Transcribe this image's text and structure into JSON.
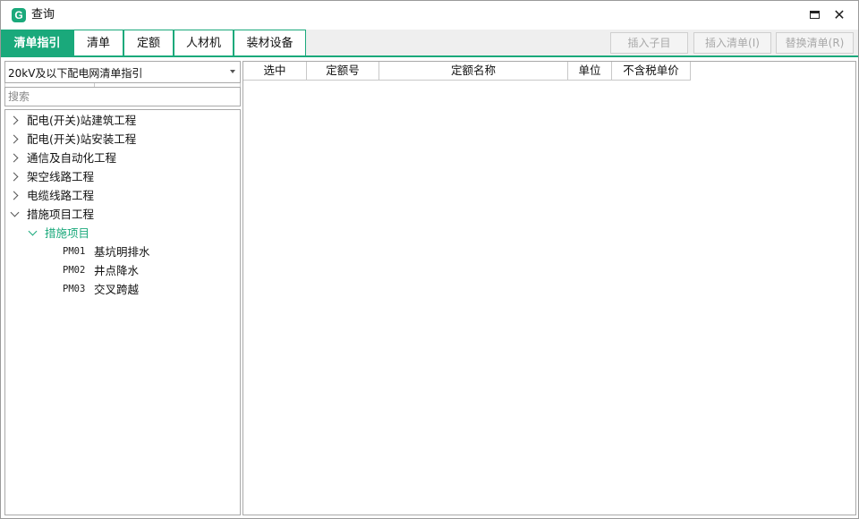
{
  "window": {
    "title": "查询",
    "logo_letter": "G",
    "accent_color": "#1aa97b"
  },
  "tabs": [
    {
      "label": "清单指引",
      "active": true
    },
    {
      "label": "清单",
      "active": false
    },
    {
      "label": "定额",
      "active": false
    },
    {
      "label": "人材机",
      "active": false
    },
    {
      "label": "装材设备",
      "active": false
    }
  ],
  "toolbar": {
    "insert_child": "插入子目",
    "insert_list": "插入清单(I)",
    "replace_list": "替换清单(R)"
  },
  "left_panel": {
    "guide_select_value": "20kV及以下配电网清单指引",
    "search_placeholder": "搜索",
    "tree": [
      {
        "label": "配电(开关)站建筑工程",
        "expanded": false
      },
      {
        "label": "配电(开关)站安装工程",
        "expanded": false
      },
      {
        "label": "通信及自动化工程",
        "expanded": false
      },
      {
        "label": "架空线路工程",
        "expanded": false
      },
      {
        "label": "电缆线路工程",
        "expanded": false
      },
      {
        "label": "措施项目工程",
        "expanded": true
      },
      {
        "label": "措施项目",
        "expanded": true,
        "selected": true
      },
      {
        "code": "PM01",
        "label": "基坑明排水"
      },
      {
        "code": "PM02",
        "label": "井点降水"
      },
      {
        "code": "PM03",
        "label": "交叉跨越"
      }
    ]
  },
  "grid": {
    "columns": [
      "选中",
      "定额号",
      "定额名称",
      "单位",
      "不含税单价"
    ]
  }
}
